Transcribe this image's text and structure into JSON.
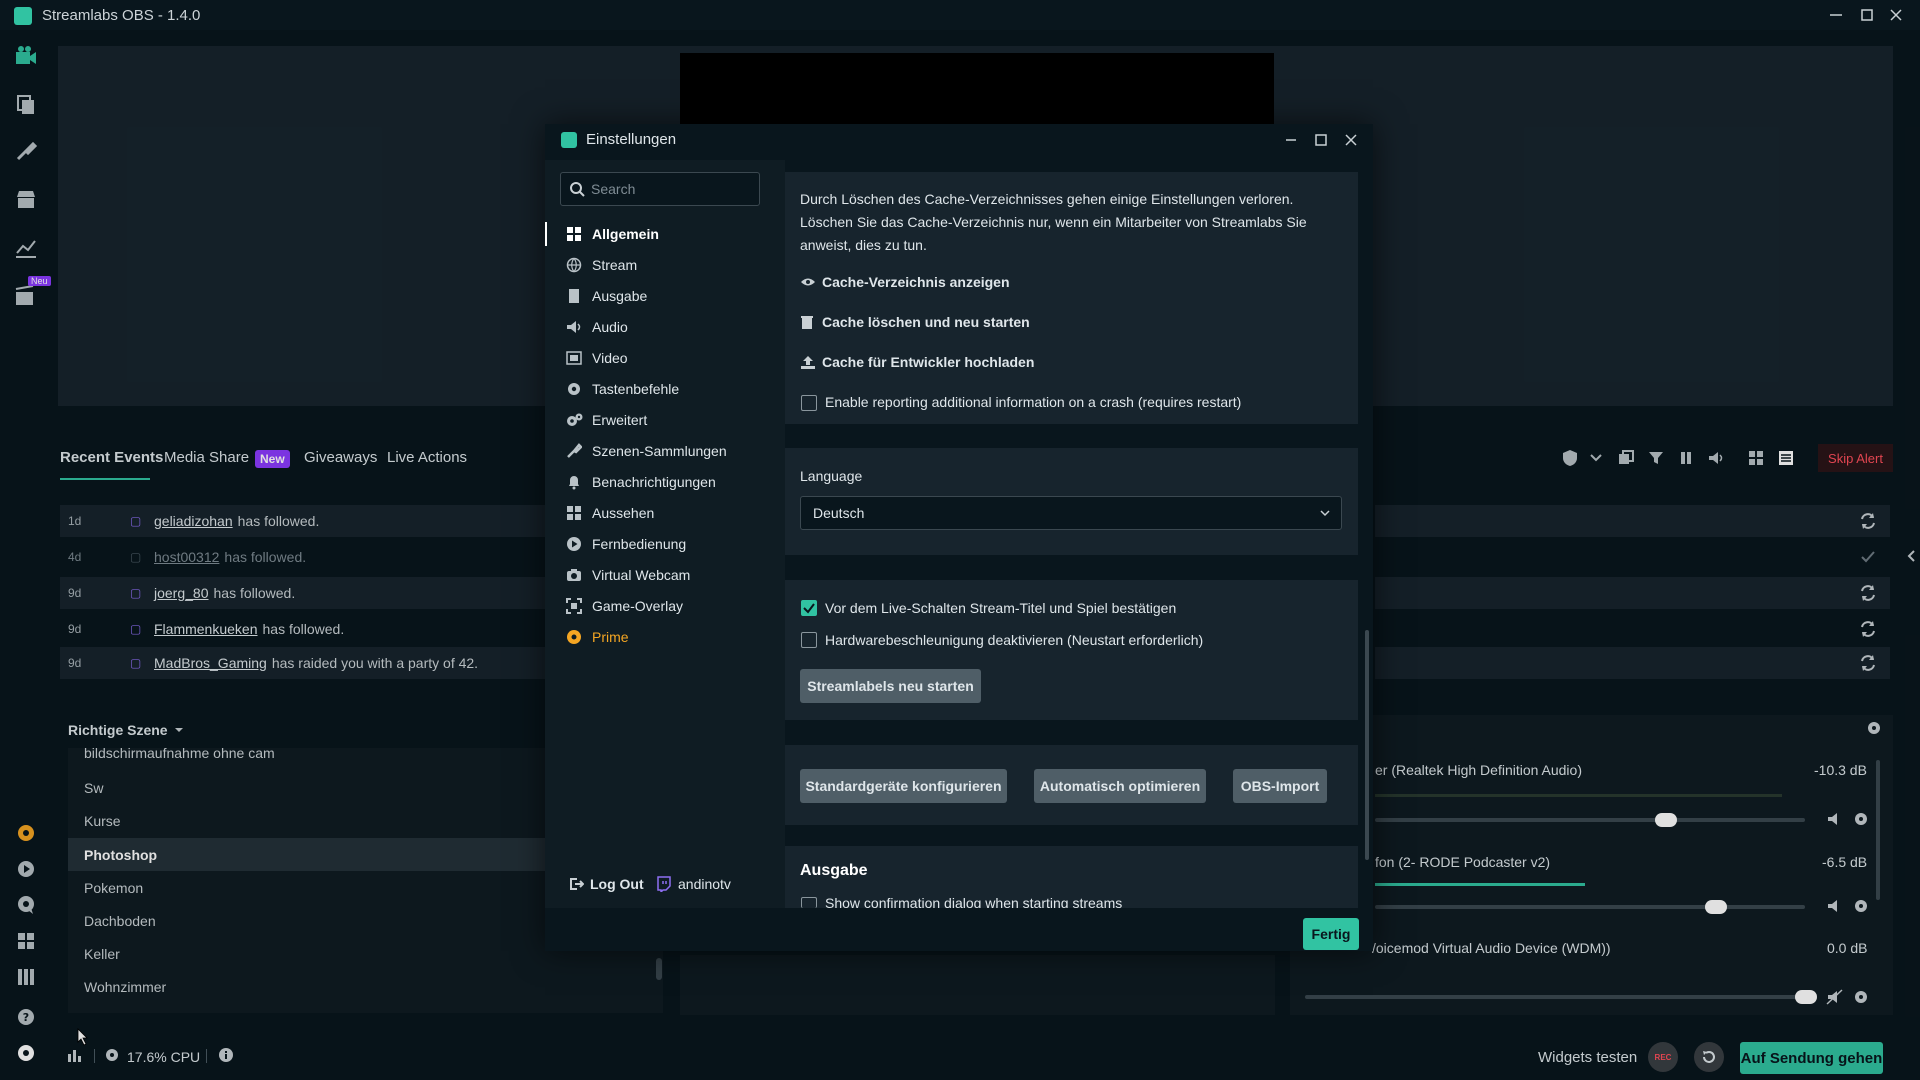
{
  "app": {
    "title": "Streamlabs OBS - 1.4.0"
  },
  "leftnav": {
    "badge_new": "Neu"
  },
  "events": {
    "tabs": [
      "Recent Events",
      "Media Share",
      "Giveaways",
      "Live Actions"
    ],
    "media_share_badge": "New",
    "skip_alert": "Skip Alert",
    "rows": [
      {
        "time": "1d",
        "user": "geliadizohan",
        "text": "has followed."
      },
      {
        "time": "4d",
        "user": "host00312",
        "text": "has followed."
      },
      {
        "time": "9d",
        "user": "joerg_80",
        "text": "has followed."
      },
      {
        "time": "9d",
        "user": "Flammenkueken",
        "text": "has followed."
      },
      {
        "time": "9d",
        "user": "MadBros_Gaming",
        "text": "has raided you with a party of 42."
      }
    ]
  },
  "scenes": {
    "title": "Richtige Szene",
    "items": [
      "bildschirmaufnahme ohne cam",
      "Sw",
      "Kurse",
      "Photoshop",
      "Pokemon",
      "Dachboden",
      "Keller",
      "Wohnzimmer"
    ],
    "active": "Photoshop"
  },
  "mixer": {
    "channels": [
      {
        "name": "er (Realtek High Definition Audio)",
        "db": "-10.3 dB",
        "level": 0.6
      },
      {
        "name": "fon (2- RODE Podcaster v2)",
        "db": "-6.5 dB",
        "level": 0.76
      },
      {
        "name": "/oicemod Virtual Audio Device (WDM))",
        "db": "0.0 dB",
        "level": 1.0
      }
    ]
  },
  "status": {
    "cpu": "17.6% CPU",
    "widgets_test": "Widgets testen",
    "rec": "REC",
    "go_live": "Auf Sendung gehen"
  },
  "dialog": {
    "title": "Einstellungen",
    "search_placeholder": "Search",
    "sidebar": [
      {
        "label": "Allgemein",
        "icon": "grid-icon"
      },
      {
        "label": "Stream",
        "icon": "globe-icon"
      },
      {
        "label": "Ausgabe",
        "icon": "book-icon"
      },
      {
        "label": "Audio",
        "icon": "speaker-icon"
      },
      {
        "label": "Video",
        "icon": "film-icon"
      },
      {
        "label": "Tastenbefehle",
        "icon": "cog-icon"
      },
      {
        "label": "Erweitert",
        "icon": "cogs-icon"
      },
      {
        "label": "Szenen-Sammlungen",
        "icon": "brush-icon"
      },
      {
        "label": "Benachrichtigungen",
        "icon": "bell-icon"
      },
      {
        "label": "Aussehen",
        "icon": "people-icon"
      },
      {
        "label": "Fernbedienung",
        "icon": "play-circle-icon"
      },
      {
        "label": "Virtual Webcam",
        "icon": "camera-icon"
      },
      {
        "label": "Game-Overlay",
        "icon": "expand-icon"
      },
      {
        "label": "Prime",
        "icon": "prime-icon"
      }
    ],
    "active_item": "Allgemein",
    "logout": "Log Out",
    "account": "andinotv",
    "cache_text": "Durch Löschen des Cache-Verzeichnisses gehen einige Einstellungen verloren. Löschen Sie das Cache-Verzeichnis nur, wenn ein Mitarbeiter von Streamlabs Sie anweist, dies zu tun.",
    "cache_show": "Cache-Verzeichnis anzeigen",
    "cache_delete": "Cache löschen und neu starten",
    "cache_upload": "Cache für Entwickler hochladen",
    "crash_reporting": "Enable reporting additional information on a crash (requires restart)",
    "language_label": "Language",
    "language_value": "Deutsch",
    "confirm_title": "Vor dem Live-Schalten Stream-Titel und Spiel bestätigen",
    "disable_hw_accel": "Hardwarebeschleunigung deaktivieren (Neustart erforderlich)",
    "restart_labels": "Streamlabels neu starten",
    "btn_default_devices": "Standardgeräte konfigurieren",
    "btn_auto_optimize": "Automatisch optimieren",
    "btn_obs_import": "OBS-Import",
    "section_output": "Ausgabe",
    "show_confirmation": "Show confirmation dialog when starting streams",
    "done": "Fertig"
  }
}
